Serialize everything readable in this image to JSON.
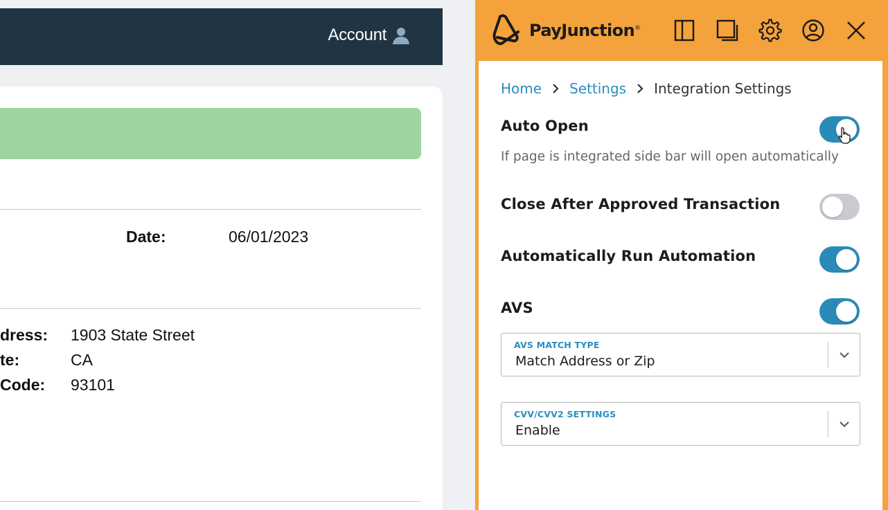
{
  "app": {
    "account_label": "Account",
    "details": {
      "date_label": "Date:",
      "date_value": "06/01/2023",
      "address_label": "dress:",
      "address_value": "1903 State Street",
      "state_label": "te:",
      "state_value": "CA",
      "zip_label": "Code:",
      "zip_value": "93101"
    }
  },
  "panel": {
    "brand": "PayJunction",
    "brand_mark": "®",
    "header_icons": [
      "sidebar-icon",
      "popout-icon",
      "settings-gear-icon",
      "user-profile-icon",
      "close-icon"
    ],
    "breadcrumb": {
      "home": "Home",
      "settings": "Settings",
      "current": "Integration Settings"
    },
    "settings": {
      "auto_open": {
        "title": "Auto Open",
        "description": "If page is integrated side bar will open automatically",
        "enabled": true
      },
      "close_after_approved": {
        "title": "Close After Approved Transaction",
        "enabled": false
      },
      "auto_run_automation": {
        "title": "Automatically Run Automation",
        "enabled": true
      },
      "avs": {
        "title": "AVS",
        "enabled": true
      }
    },
    "avs_match_type": {
      "label": "AVS MATCH TYPE",
      "value": "Match Address or Zip"
    },
    "cvv_settings": {
      "label": "CVV/CVV2 SETTINGS",
      "value": "Enable"
    }
  },
  "colors": {
    "topbar": "#203444",
    "panel_frame": "#f4a23b",
    "accent_blue": "#2a8ec0",
    "toggle_on": "#2b8bb8",
    "toggle_off": "#c8ccd0",
    "success_banner": "#9ed49e"
  }
}
